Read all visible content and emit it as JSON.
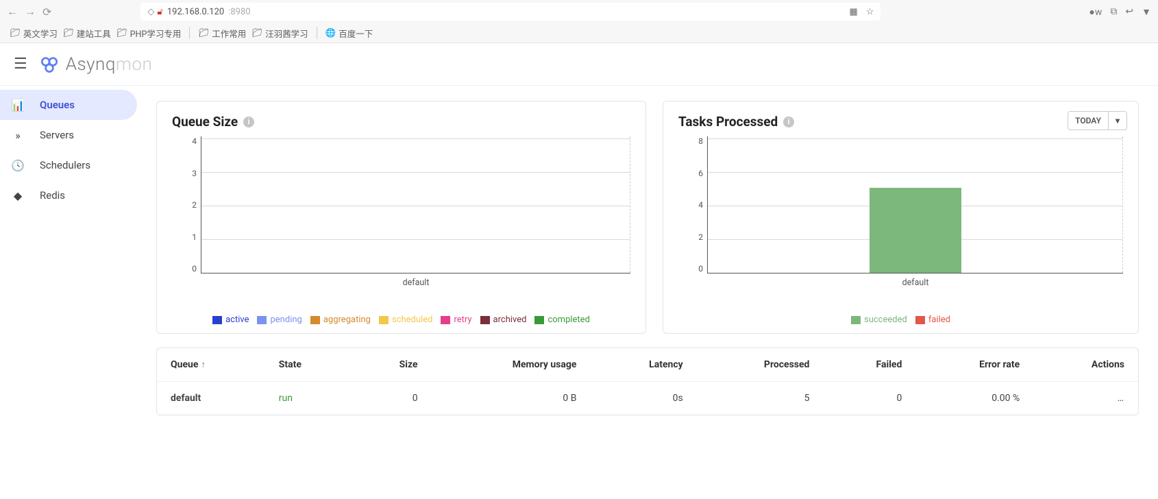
{
  "browser": {
    "url_host": "192.168.0.120",
    "url_port": ":8980",
    "bookmarks": [
      {
        "label": "英文学习"
      },
      {
        "label": "建站工具"
      },
      {
        "label": "PHP学习专用"
      },
      {
        "sep": true
      },
      {
        "label": "工作常用"
      },
      {
        "label": "汪羽茜学习"
      },
      {
        "sep": true
      },
      {
        "label": "百度一下",
        "icon": "globe"
      }
    ]
  },
  "app": {
    "brand_a": "Asynq",
    "brand_b": "mon"
  },
  "sidebar": {
    "items": [
      {
        "label": "Queues",
        "icon": "bar-chart",
        "active": true
      },
      {
        "label": "Servers",
        "icon": "chevrons",
        "active": false
      },
      {
        "label": "Schedulers",
        "icon": "clock",
        "active": false
      },
      {
        "label": "Redis",
        "icon": "layers",
        "active": false
      }
    ]
  },
  "queue_size_card": {
    "title": "Queue Size",
    "x_category": "default",
    "legend": [
      {
        "label": "active",
        "color": "#2a3fd0"
      },
      {
        "label": "pending",
        "color": "#7a93f0"
      },
      {
        "label": "aggregating",
        "color": "#d58a2c"
      },
      {
        "label": "scheduled",
        "color": "#f2c84b"
      },
      {
        "label": "retry",
        "color": "#e63e8c"
      },
      {
        "label": "archived",
        "color": "#7a2f3a"
      },
      {
        "label": "completed",
        "color": "#3a9a3a"
      }
    ]
  },
  "tasks_card": {
    "title": "Tasks Processed",
    "range_label": "TODAY",
    "x_category": "default",
    "legend": [
      {
        "label": "succeeded",
        "color": "#7cb87c"
      },
      {
        "label": "failed",
        "color": "#e2574c"
      }
    ]
  },
  "table": {
    "headers": {
      "queue": "Queue",
      "state": "State",
      "size": "Size",
      "memory": "Memory usage",
      "latency": "Latency",
      "processed": "Processed",
      "failed": "Failed",
      "error_rate": "Error rate",
      "actions": "Actions"
    },
    "rows": [
      {
        "queue": "default",
        "state": "run",
        "size": "0",
        "memory": "0 B",
        "latency": "0s",
        "processed": "5",
        "failed": "0",
        "error_rate": "0.00 %"
      }
    ]
  },
  "chart_data": [
    {
      "type": "bar",
      "title": "Queue Size",
      "categories": [
        "default"
      ],
      "series": [
        {
          "name": "active",
          "values": [
            0
          ]
        },
        {
          "name": "pending",
          "values": [
            0
          ]
        },
        {
          "name": "aggregating",
          "values": [
            0
          ]
        },
        {
          "name": "scheduled",
          "values": [
            0
          ]
        },
        {
          "name": "retry",
          "values": [
            0
          ]
        },
        {
          "name": "archived",
          "values": [
            0
          ]
        },
        {
          "name": "completed",
          "values": [
            0
          ]
        }
      ],
      "ylim": [
        0,
        4
      ],
      "yticks": [
        0,
        1,
        2,
        3,
        4
      ],
      "xlabel": "",
      "ylabel": ""
    },
    {
      "type": "bar",
      "title": "Tasks Processed",
      "categories": [
        "default"
      ],
      "series": [
        {
          "name": "succeeded",
          "values": [
            5
          ]
        },
        {
          "name": "failed",
          "values": [
            0
          ]
        }
      ],
      "ylim": [
        0,
        8
      ],
      "yticks": [
        0,
        2,
        4,
        6,
        8
      ],
      "xlabel": "",
      "ylabel": ""
    }
  ]
}
